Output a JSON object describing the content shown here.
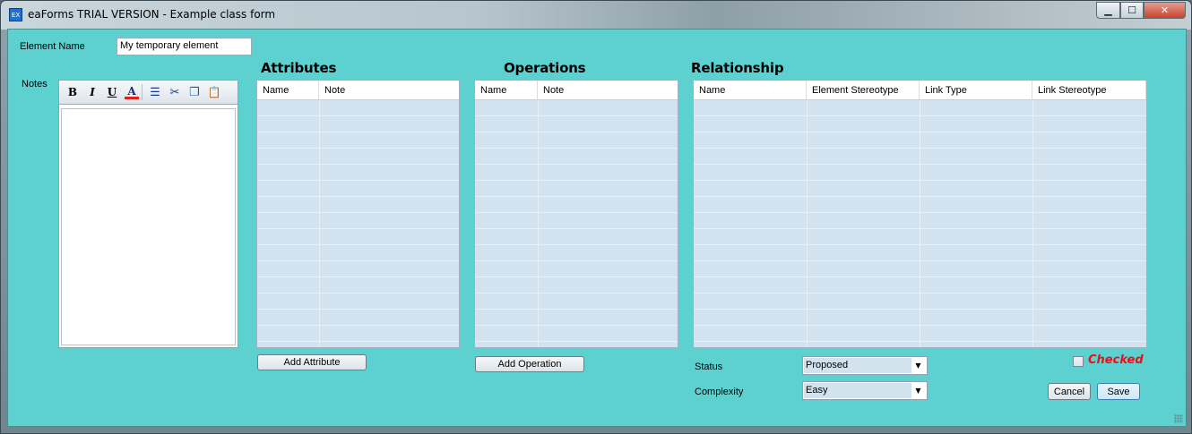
{
  "window": {
    "icon_text": "EX",
    "title": "eaForms TRIAL VERSION - Example class form",
    "minimize_glyph": "▁",
    "maximize_glyph": "☐",
    "close_glyph": "✕"
  },
  "form": {
    "element_name_label": "Element Name",
    "element_name_value": "My temporary element",
    "notes_label": "Notes",
    "toolbar": {
      "bold": "B",
      "italic": "I",
      "underline": "U",
      "font_color": "A",
      "list": "☰",
      "cut": "✂",
      "copy": "❐",
      "paste": "📋"
    }
  },
  "attributes": {
    "heading": "Attributes",
    "columns": [
      "Name",
      "Note"
    ],
    "add_button": "Add Attribute"
  },
  "operations": {
    "heading": "Operations",
    "columns": [
      "Name",
      "Note"
    ],
    "add_button": "Add Operation"
  },
  "relationship": {
    "heading": "Relationship",
    "columns": [
      "Name",
      "Element Stereotype",
      "Link Type",
      "Link Stereotype"
    ]
  },
  "status": {
    "label": "Status",
    "value": "Proposed"
  },
  "complexity": {
    "label": "Complexity",
    "value": "Easy"
  },
  "checked": {
    "label": "Checked"
  },
  "buttons": {
    "cancel": "Cancel",
    "save": "Save"
  },
  "colors": {
    "client_bg": "#5cd1d0",
    "grid_bg": "#d3e2ef",
    "checked_red": "#e8101a"
  }
}
